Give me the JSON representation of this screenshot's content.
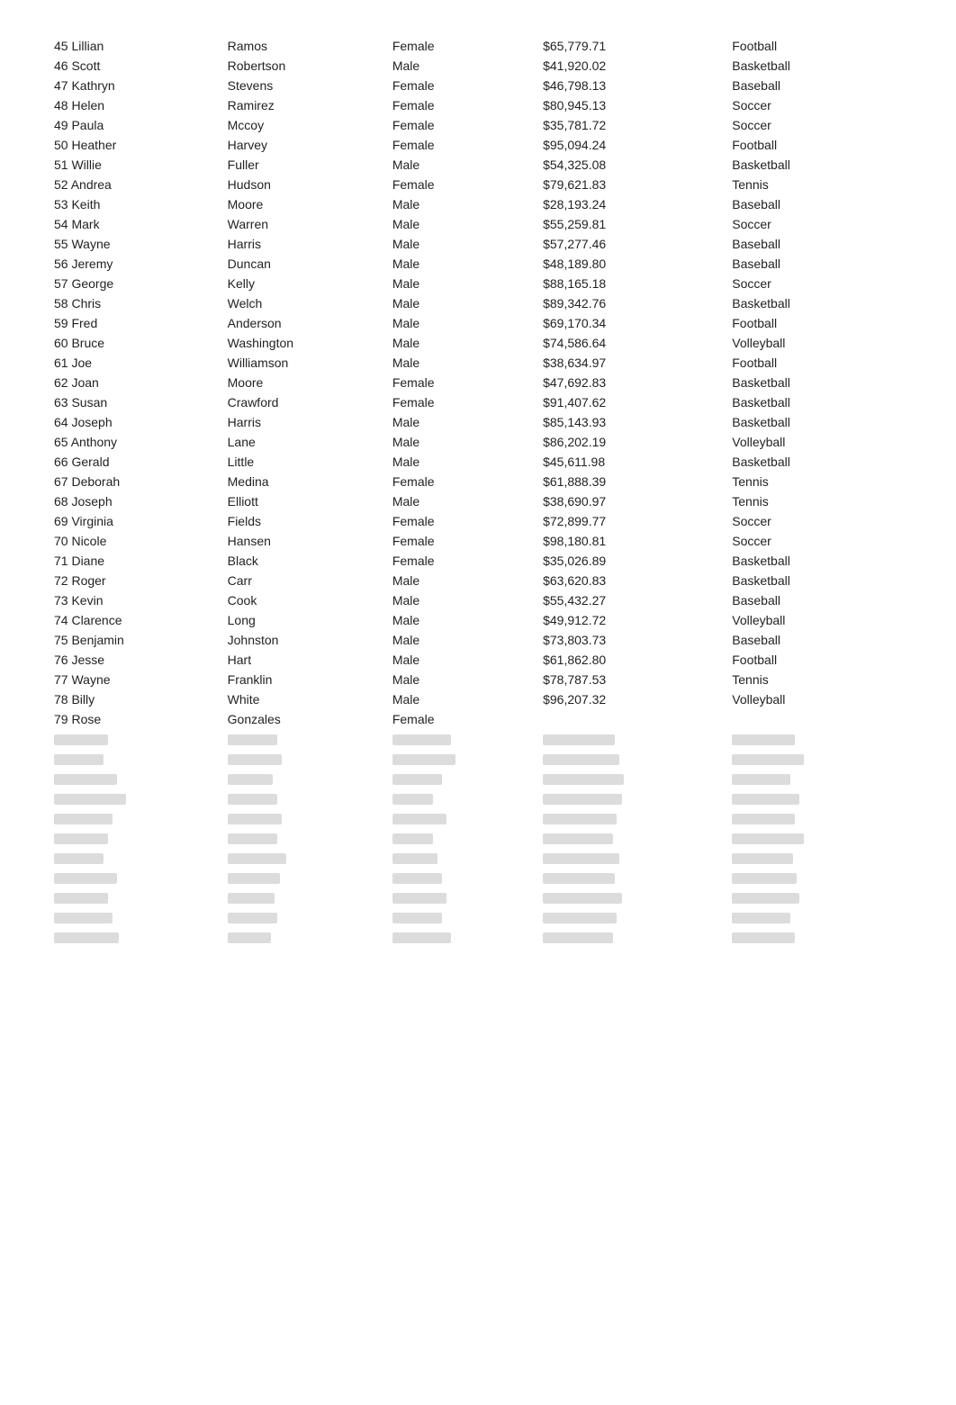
{
  "rows": [
    {
      "id": 45,
      "first": "Lillian",
      "last": "Ramos",
      "gender": "Female",
      "salary": "$65,779.71",
      "sport": "Football"
    },
    {
      "id": 46,
      "first": "Scott",
      "last": "Robertson",
      "gender": "Male",
      "salary": "$41,920.02",
      "sport": "Basketball"
    },
    {
      "id": 47,
      "first": "Kathryn",
      "last": "Stevens",
      "gender": "Female",
      "salary": "$46,798.13",
      "sport": "Baseball"
    },
    {
      "id": 48,
      "first": "Helen",
      "last": "Ramirez",
      "gender": "Female",
      "salary": "$80,945.13",
      "sport": "Soccer"
    },
    {
      "id": 49,
      "first": "Paula",
      "last": "Mccoy",
      "gender": "Female",
      "salary": "$35,781.72",
      "sport": "Soccer"
    },
    {
      "id": 50,
      "first": "Heather",
      "last": "Harvey",
      "gender": "Female",
      "salary": "$95,094.24",
      "sport": "Football"
    },
    {
      "id": 51,
      "first": "Willie",
      "last": "Fuller",
      "gender": "Male",
      "salary": "$54,325.08",
      "sport": "Basketball"
    },
    {
      "id": 52,
      "first": "Andrea",
      "last": "Hudson",
      "gender": "Female",
      "salary": "$79,621.83",
      "sport": "Tennis"
    },
    {
      "id": 53,
      "first": "Keith",
      "last": "Moore",
      "gender": "Male",
      "salary": "$28,193.24",
      "sport": "Baseball"
    },
    {
      "id": 54,
      "first": "Mark",
      "last": "Warren",
      "gender": "Male",
      "salary": "$55,259.81",
      "sport": "Soccer"
    },
    {
      "id": 55,
      "first": "Wayne",
      "last": "Harris",
      "gender": "Male",
      "salary": "$57,277.46",
      "sport": "Baseball"
    },
    {
      "id": 56,
      "first": "Jeremy",
      "last": "Duncan",
      "gender": "Male",
      "salary": "$48,189.80",
      "sport": "Baseball"
    },
    {
      "id": 57,
      "first": "George",
      "last": "Kelly",
      "gender": "Male",
      "salary": "$88,165.18",
      "sport": "Soccer"
    },
    {
      "id": 58,
      "first": "Chris",
      "last": "Welch",
      "gender": "Male",
      "salary": "$89,342.76",
      "sport": "Basketball"
    },
    {
      "id": 59,
      "first": "Fred",
      "last": "Anderson",
      "gender": "Male",
      "salary": "$69,170.34",
      "sport": "Football"
    },
    {
      "id": 60,
      "first": "Bruce",
      "last": "Washington",
      "gender": "Male",
      "salary": "$74,586.64",
      "sport": "Volleyball"
    },
    {
      "id": 61,
      "first": "Joe",
      "last": "Williamson",
      "gender": "Male",
      "salary": "$38,634.97",
      "sport": "Football"
    },
    {
      "id": 62,
      "first": "Joan",
      "last": "Moore",
      "gender": "Female",
      "salary": "$47,692.83",
      "sport": "Basketball"
    },
    {
      "id": 63,
      "first": "Susan",
      "last": "Crawford",
      "gender": "Female",
      "salary": "$91,407.62",
      "sport": "Basketball"
    },
    {
      "id": 64,
      "first": "Joseph",
      "last": "Harris",
      "gender": "Male",
      "salary": "$85,143.93",
      "sport": "Basketball"
    },
    {
      "id": 65,
      "first": "Anthony",
      "last": "Lane",
      "gender": "Male",
      "salary": "$86,202.19",
      "sport": "Volleyball"
    },
    {
      "id": 66,
      "first": "Gerald",
      "last": "Little",
      "gender": "Male",
      "salary": "$45,611.98",
      "sport": "Basketball"
    },
    {
      "id": 67,
      "first": "Deborah",
      "last": "Medina",
      "gender": "Female",
      "salary": "$61,888.39",
      "sport": "Tennis"
    },
    {
      "id": 68,
      "first": "Joseph",
      "last": "Elliott",
      "gender": "Male",
      "salary": "$38,690.97",
      "sport": "Tennis"
    },
    {
      "id": 69,
      "first": "Virginia",
      "last": "Fields",
      "gender": "Female",
      "salary": "$72,899.77",
      "sport": "Soccer"
    },
    {
      "id": 70,
      "first": "Nicole",
      "last": "Hansen",
      "gender": "Female",
      "salary": "$98,180.81",
      "sport": "Soccer"
    },
    {
      "id": 71,
      "first": "Diane",
      "last": "Black",
      "gender": "Female",
      "salary": "$35,026.89",
      "sport": "Basketball"
    },
    {
      "id": 72,
      "first": "Roger",
      "last": "Carr",
      "gender": "Male",
      "salary": "$63,620.83",
      "sport": "Basketball"
    },
    {
      "id": 73,
      "first": "Kevin",
      "last": "Cook",
      "gender": "Male",
      "salary": "$55,432.27",
      "sport": "Baseball"
    },
    {
      "id": 74,
      "first": "Clarence",
      "last": "Long",
      "gender": "Male",
      "salary": "$49,912.72",
      "sport": "Volleyball"
    },
    {
      "id": 75,
      "first": "Benjamin",
      "last": "Johnston",
      "gender": "Male",
      "salary": "$73,803.73",
      "sport": "Baseball"
    },
    {
      "id": 76,
      "first": "Jesse",
      "last": "Hart",
      "gender": "Male",
      "salary": "$61,862.80",
      "sport": "Football"
    },
    {
      "id": 77,
      "first": "Wayne",
      "last": "Franklin",
      "gender": "Male",
      "salary": "$78,787.53",
      "sport": "Tennis"
    },
    {
      "id": 78,
      "first": "Billy",
      "last": "White",
      "gender": "Male",
      "salary": "$96,207.32",
      "sport": "Volleyball"
    },
    {
      "id": 79,
      "first": "Rose",
      "last": "Gonzales",
      "gender": "Female",
      "salary": "",
      "sport": ""
    }
  ],
  "blurred_rows": [
    {
      "widths": [
        60,
        55,
        65,
        80,
        70
      ]
    },
    {
      "widths": [
        55,
        60,
        70,
        85,
        80
      ]
    },
    {
      "widths": [
        70,
        50,
        55,
        90,
        65
      ]
    },
    {
      "widths": [
        80,
        55,
        45,
        88,
        75
      ]
    },
    {
      "widths": [
        65,
        60,
        60,
        82,
        70
      ]
    },
    {
      "widths": [
        60,
        55,
        45,
        78,
        80
      ]
    },
    {
      "widths": [
        55,
        65,
        50,
        85,
        68
      ]
    },
    {
      "widths": [
        70,
        58,
        55,
        80,
        72
      ]
    },
    {
      "widths": [
        60,
        52,
        60,
        88,
        75
      ]
    },
    {
      "widths": [
        65,
        55,
        55,
        82,
        65
      ]
    },
    {
      "widths": [
        72,
        48,
        65,
        78,
        70
      ]
    }
  ]
}
